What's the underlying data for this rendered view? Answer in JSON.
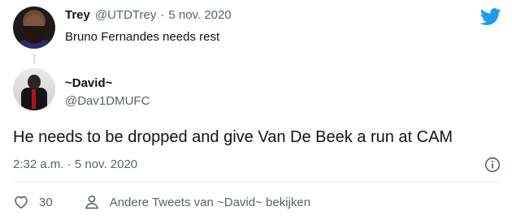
{
  "reply": {
    "name": "Trey",
    "handle": "@UTDTrey",
    "separator": "·",
    "date": "5 nov. 2020",
    "text": "Bruno Fernandes needs rest"
  },
  "tweet": {
    "name": "~David~",
    "handle": "@Dav1DMUFC",
    "text": "He needs to be dropped and give Van De Beek a run at CAM",
    "timestamp": "2:32 a.m. · 5 nov. 2020"
  },
  "actions": {
    "like_count": "30",
    "more_tweets_label": "Andere Tweets van ~David~ bekijken"
  },
  "icons": {
    "logo": "twitter-bird-icon",
    "info": "info-icon",
    "like": "heart-icon",
    "profile": "person-icon"
  },
  "colors": {
    "brand": "#1d9bf0",
    "text": "#0f1419",
    "muted": "#536471"
  }
}
